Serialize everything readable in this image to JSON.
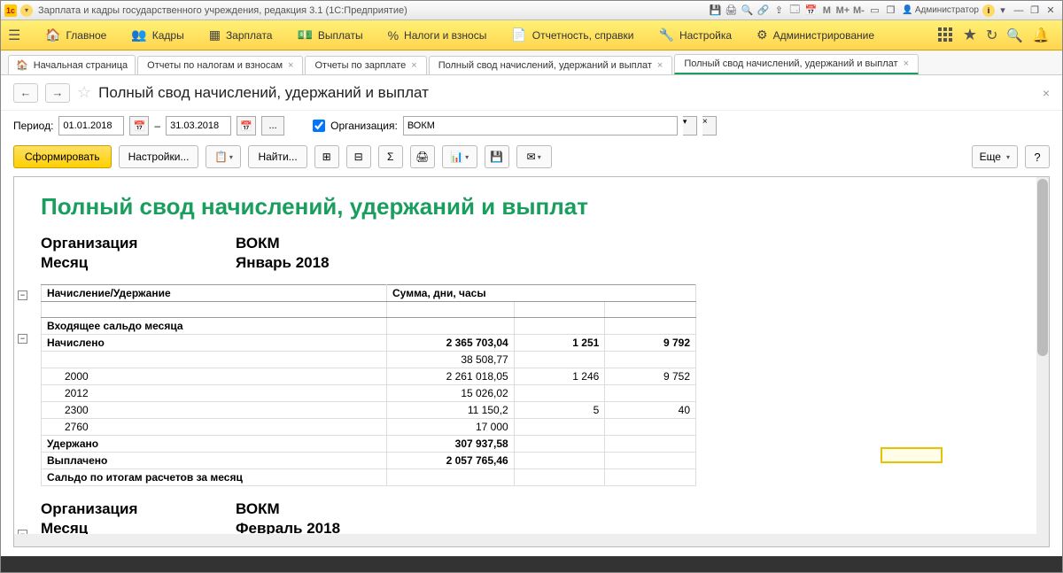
{
  "titlebar": {
    "app_title": "Зарплата и кадры государственного учреждения, редакция 3.1  (1С:Предприятие)",
    "user": "Администратор",
    "m_labels": [
      "M",
      "M+",
      "M-"
    ]
  },
  "mainmenu": {
    "items": [
      {
        "icon": "home",
        "label": "Главное"
      },
      {
        "icon": "people",
        "label": "Кадры"
      },
      {
        "icon": "table",
        "label": "Зарплата"
      },
      {
        "icon": "money",
        "label": "Выплаты"
      },
      {
        "icon": "percent",
        "label": "Налоги и взносы"
      },
      {
        "icon": "doc",
        "label": "Отчетность, справки"
      },
      {
        "icon": "wrench",
        "label": "Настройка"
      },
      {
        "icon": "gear",
        "label": "Администрирование"
      }
    ]
  },
  "tabs": {
    "home_label": "Начальная страница",
    "items": [
      "Отчеты по налогам и взносам",
      "Отчеты по зарплате",
      "Полный свод начислений, удержаний и выплат",
      "Полный свод начислений, удержаний и выплат"
    ],
    "active_index": 3
  },
  "page": {
    "title": "Полный свод начислений, удержаний и выплат"
  },
  "filters": {
    "period_label": "Период:",
    "date_from": "01.01.2018",
    "date_to": "31.03.2018",
    "dash": "–",
    "org_label": "Организация:",
    "org_value": "ВОКМ"
  },
  "toolbar": {
    "generate": "Сформировать",
    "settings": "Настройки...",
    "find": "Найти...",
    "more": "Еще"
  },
  "report": {
    "title": "Полный свод начислений, удержаний и выплат",
    "blocks": [
      {
        "org_label": "Организация",
        "org": "ВОКМ",
        "month_label": "Месяц",
        "month": "Январь 2018"
      },
      {
        "org_label": "Организация",
        "org": "ВОКМ",
        "month_label": "Месяц",
        "month": "Февраль 2018"
      }
    ],
    "col1": "Начисление/Удержание",
    "col2": "Сумма, дни, часы",
    "rows": [
      {
        "label": "Входящее сальдо месяца",
        "c1": "",
        "c2": "",
        "c3": ""
      },
      {
        "label": "Начислено",
        "c1": "2 365 703,04",
        "c2": "1 251",
        "c3": "9 792",
        "bold": true
      },
      {
        "label": "",
        "c1": "38 508,77",
        "c2": "",
        "c3": "",
        "sub": true
      },
      {
        "label": "2000",
        "c1": "2 261 018,05",
        "c2": "1 246",
        "c3": "9 752",
        "sub": true
      },
      {
        "label": "2012",
        "c1": "15 026,02",
        "c2": "",
        "c3": "",
        "sub": true
      },
      {
        "label": "2300",
        "c1": "11 150,2",
        "c2": "5",
        "c3": "40",
        "sub": true
      },
      {
        "label": "2760",
        "c1": "17 000",
        "c2": "",
        "c3": "",
        "sub": true
      },
      {
        "label": "Удержано",
        "c1": "307 937,58",
        "c2": "",
        "c3": "",
        "bold": true
      },
      {
        "label": "Выплачено",
        "c1": "2 057 765,46",
        "c2": "",
        "c3": "",
        "bold": true
      },
      {
        "label": "Сальдо по итогам расчетов за месяц",
        "c1": "",
        "c2": "",
        "c3": "",
        "bold": true
      }
    ]
  }
}
